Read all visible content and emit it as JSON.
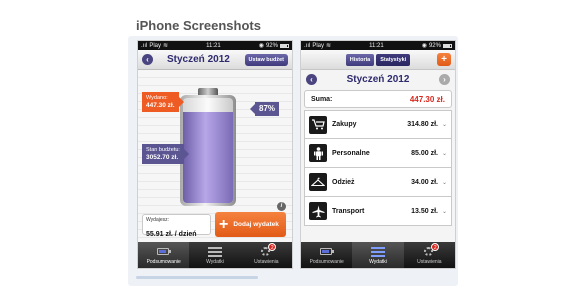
{
  "section_title": "iPhone Screenshots",
  "status": {
    "carrier": "Play",
    "time": "11:21",
    "battery": "92%"
  },
  "left_phone": {
    "title": "Styczeń 2012",
    "set_budget_label": "Ustaw budżet",
    "spent": {
      "label": "Wydano:",
      "value": "447.30 zł."
    },
    "budget": {
      "label": "Stan budżetu:",
      "value": "3052.70 zł."
    },
    "percent": {
      "text": "87%",
      "fill_fraction": 0.87
    },
    "daily": {
      "label": "Wydajesz:",
      "value": "55.91 zł. / dzień"
    },
    "add_button": {
      "symbol": "+",
      "label": "Dodaj wydatek"
    },
    "info_icon": "i"
  },
  "right_phone": {
    "tabs": [
      "Historia",
      "Statystyki"
    ],
    "plus_symbol": "+",
    "title": "Styczeń 2012",
    "sum_label": "Suma:",
    "sum_value": "447.30 zł.",
    "categories": [
      {
        "name": "Zakupy",
        "value": "314.80 zł.",
        "icon": "cart-icon"
      },
      {
        "name": "Personalne",
        "value": "85.00 zł.",
        "icon": "person-icon"
      },
      {
        "name": "Odzież",
        "value": "34.00 zł.",
        "icon": "hanger-icon"
      },
      {
        "name": "Transport",
        "value": "13.50 zł.",
        "icon": "plane-icon"
      }
    ],
    "chevron": "⌄"
  },
  "tabbar": [
    {
      "label": "Podsumowanie",
      "icon": "battery-icon"
    },
    {
      "label": "Wydatki",
      "icon": "list-icon"
    },
    {
      "label": "Ustawienia",
      "icon": "gear-icon",
      "badge": "2"
    }
  ],
  "colors": {
    "accent_purple": "#4a4580",
    "accent_orange": "#ee5b23",
    "sum_red": "#d9281e"
  }
}
